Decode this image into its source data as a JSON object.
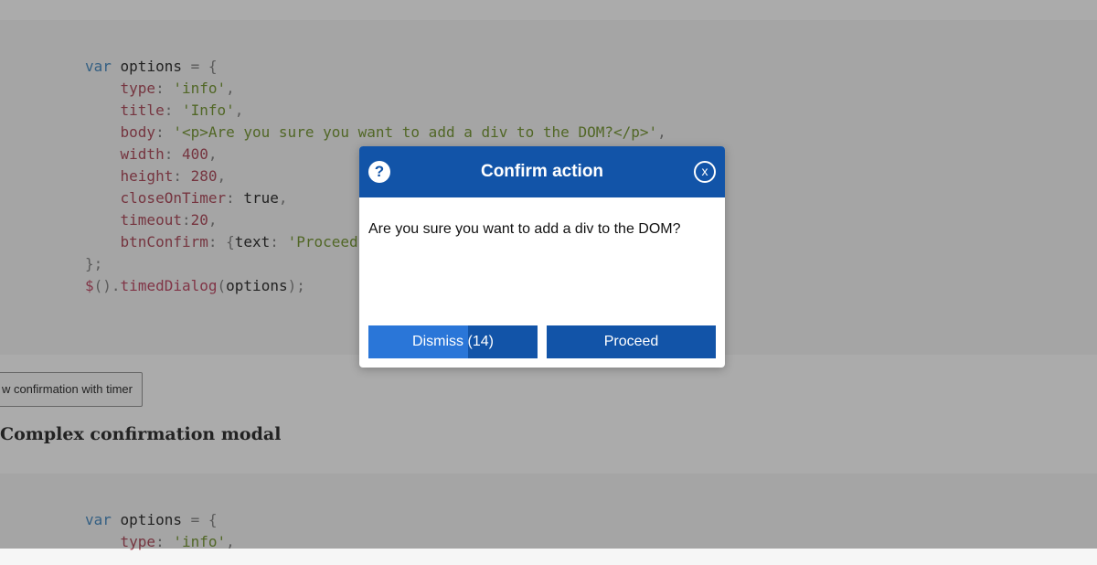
{
  "background": {
    "code_block_1": [
      [
        [
          "kw",
          "var"
        ],
        [
          "plain",
          " options "
        ],
        [
          "pun",
          "= {"
        ]
      ],
      [
        [
          "plain",
          "    "
        ],
        [
          "prop",
          "type"
        ],
        [
          "pun",
          ": "
        ],
        [
          "str",
          "'info'"
        ],
        [
          "pun",
          ","
        ]
      ],
      [
        [
          "plain",
          "    "
        ],
        [
          "prop",
          "title"
        ],
        [
          "pun",
          ": "
        ],
        [
          "str",
          "'Info'"
        ],
        [
          "pun",
          ","
        ]
      ],
      [
        [
          "plain",
          "    "
        ],
        [
          "prop",
          "body"
        ],
        [
          "pun",
          ": "
        ],
        [
          "str",
          "'<p>Are you sure you want to add a div to the DOM?</p>'"
        ],
        [
          "pun",
          ","
        ]
      ],
      [
        [
          "plain",
          "    "
        ],
        [
          "prop",
          "width"
        ],
        [
          "pun",
          ": "
        ],
        [
          "num",
          "400"
        ],
        [
          "pun",
          ","
        ]
      ],
      [
        [
          "plain",
          "    "
        ],
        [
          "prop",
          "height"
        ],
        [
          "pun",
          ": "
        ],
        [
          "num",
          "280"
        ],
        [
          "pun",
          ","
        ]
      ],
      [
        [
          "plain",
          "    "
        ],
        [
          "prop",
          "closeOnTimer"
        ],
        [
          "pun",
          ": "
        ],
        [
          "plain",
          "true"
        ],
        [
          "pun",
          ","
        ]
      ],
      [
        [
          "plain",
          "    "
        ],
        [
          "prop",
          "timeout"
        ],
        [
          "pun",
          ":"
        ],
        [
          "num",
          "20"
        ],
        [
          "pun",
          ","
        ]
      ],
      [
        [
          "plain",
          "    "
        ],
        [
          "prop",
          "btnConfirm"
        ],
        [
          "pun",
          ": {"
        ],
        [
          "plain",
          "text"
        ],
        [
          "pun",
          ": "
        ],
        [
          "str",
          "'Proceed'"
        ]
      ],
      [
        [
          "pun",
          "};"
        ]
      ],
      [
        [
          "fn",
          "$"
        ],
        [
          "pun",
          "()."
        ],
        [
          "fn",
          "timedDialog"
        ],
        [
          "pun",
          "("
        ],
        [
          "plain",
          "options"
        ],
        [
          "pun",
          ");"
        ]
      ]
    ],
    "timer_button_label": "w confirmation with timer",
    "section_heading": "Complex confirmation modal",
    "code_block_2": [
      [
        [
          "kw",
          "var"
        ],
        [
          "plain",
          " options "
        ],
        [
          "pun",
          "= {"
        ]
      ],
      [
        [
          "plain",
          "    "
        ],
        [
          "prop",
          "type"
        ],
        [
          "pun",
          ": "
        ],
        [
          "str",
          "'info'"
        ],
        [
          "pun",
          ","
        ]
      ]
    ]
  },
  "modal": {
    "info_icon": "?",
    "title": "Confirm action",
    "close_icon": "x",
    "body": "Are you sure you want to add a div to the DOM?",
    "dismiss_label": "Dismiss (14)",
    "dismiss_progress": 0.59,
    "proceed_label": "Proceed",
    "colors": {
      "header": "#1254a8",
      "progress": "#2a76d8"
    }
  }
}
